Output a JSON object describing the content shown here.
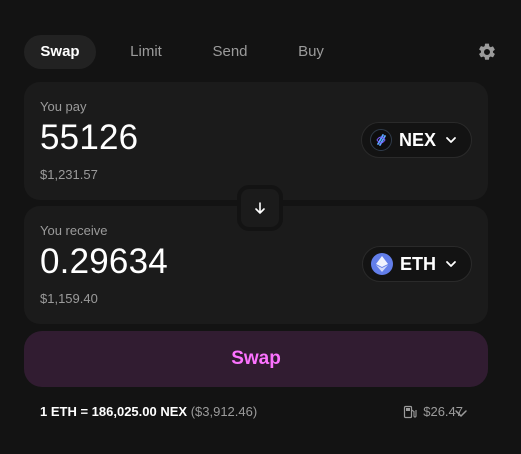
{
  "tabs": [
    {
      "label": "Swap"
    },
    {
      "label": "Limit"
    },
    {
      "label": "Send"
    },
    {
      "label": "Buy"
    }
  ],
  "icons": {
    "settings": "gear-icon",
    "swap_direction": "arrow-down-icon",
    "token_chevron": "chevron-down-icon",
    "gas": "gas-pump-icon",
    "expand": "chevron-down-icon"
  },
  "pay": {
    "label": "You pay",
    "amount": "55126",
    "usd_value": "$1,231.57",
    "token_symbol": "NEX"
  },
  "receive": {
    "label": "You receive",
    "amount": "0.29634",
    "usd_value": "$1,159.40",
    "token_symbol": "ETH"
  },
  "action": {
    "swap_label": "Swap"
  },
  "footer": {
    "rate": "1 ETH = 186,025.00 NEX",
    "rate_usd": "($3,912.46)",
    "gas_fee": "$26.47"
  },
  "colors": {
    "background": "#131313",
    "panel": "#1b1b1b",
    "accent": "#fc72ff",
    "button_bg": "#311c31",
    "muted_text": "#9b9b9b",
    "eth": "#627eea"
  }
}
